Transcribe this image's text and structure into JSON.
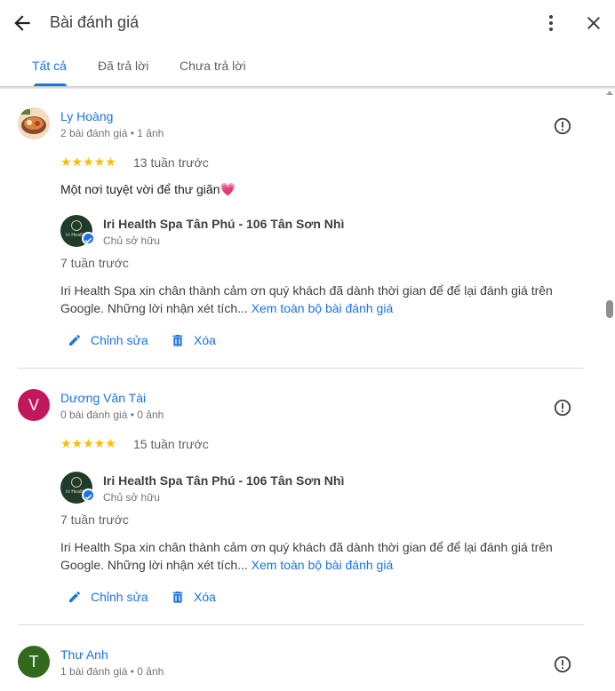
{
  "header": {
    "title": "Bài đánh giá"
  },
  "tabs": [
    {
      "label": "Tất cả"
    },
    {
      "label": "Đã trả lời"
    },
    {
      "label": "Chưa trả lời"
    }
  ],
  "reviews": [
    {
      "name": "Ly Hoàng",
      "meta": "2 bài đánh giá • 1 ảnh",
      "avatar_letter": "",
      "avatar_color": "#c96b3a",
      "rating": 5,
      "stars": "★★★★★",
      "time": "13 tuần trước",
      "text": "Một nơi tuyệt vời để thư giãn",
      "emoji": "💗",
      "owner": {
        "name": "Iri Health Spa Tân Phú - 106 Tân Sơn Nhì",
        "role": "Chủ sở hữu",
        "logo_text": "Iri Health"
      },
      "reply_time": "7 tuần trước",
      "reply_text": "Iri Health Spa xin chân thành cảm ơn quý khách đã dành thời gian để để lại đánh giá trên Google. Những lời nhận xét tích...",
      "see_more": "Xem toàn bộ bài đánh giá",
      "edit_label": "Chỉnh sửa",
      "delete_label": "Xóa"
    },
    {
      "name": "Dương Văn Tài",
      "meta": "0 bài đánh giá • 0 ảnh",
      "avatar_letter": "V",
      "avatar_color": "#c2185b",
      "rating": 5,
      "stars": "★★★★★",
      "time": "15 tuần trước",
      "owner": {
        "name": "Iri Health Spa Tân Phú - 106 Tân Sơn Nhì",
        "role": "Chủ sở hữu",
        "logo_text": "Iri Health"
      },
      "reply_time": "7 tuần trước",
      "reply_text": "Iri Health Spa xin chân thành cảm ơn quý khách đã dành thời gian để để lại đánh giá trên Google. Những lời nhận xét tích...",
      "see_more": "Xem toàn bộ bài đánh giá",
      "edit_label": "Chỉnh sửa",
      "delete_label": "Xóa"
    },
    {
      "name": "Thư Anh",
      "meta": "1 bài đánh giá • 0 ảnh",
      "avatar_letter": "T",
      "avatar_color": "#33691e"
    }
  ],
  "icons": {
    "back": "arrow-left-icon",
    "more": "more-vert-icon",
    "close": "close-icon",
    "flag": "report-icon",
    "edit": "pencil-icon",
    "delete": "trash-icon",
    "verified": "check-badge-icon"
  },
  "colors": {
    "accent": "#1a73e8",
    "star": "#fbbc04"
  }
}
